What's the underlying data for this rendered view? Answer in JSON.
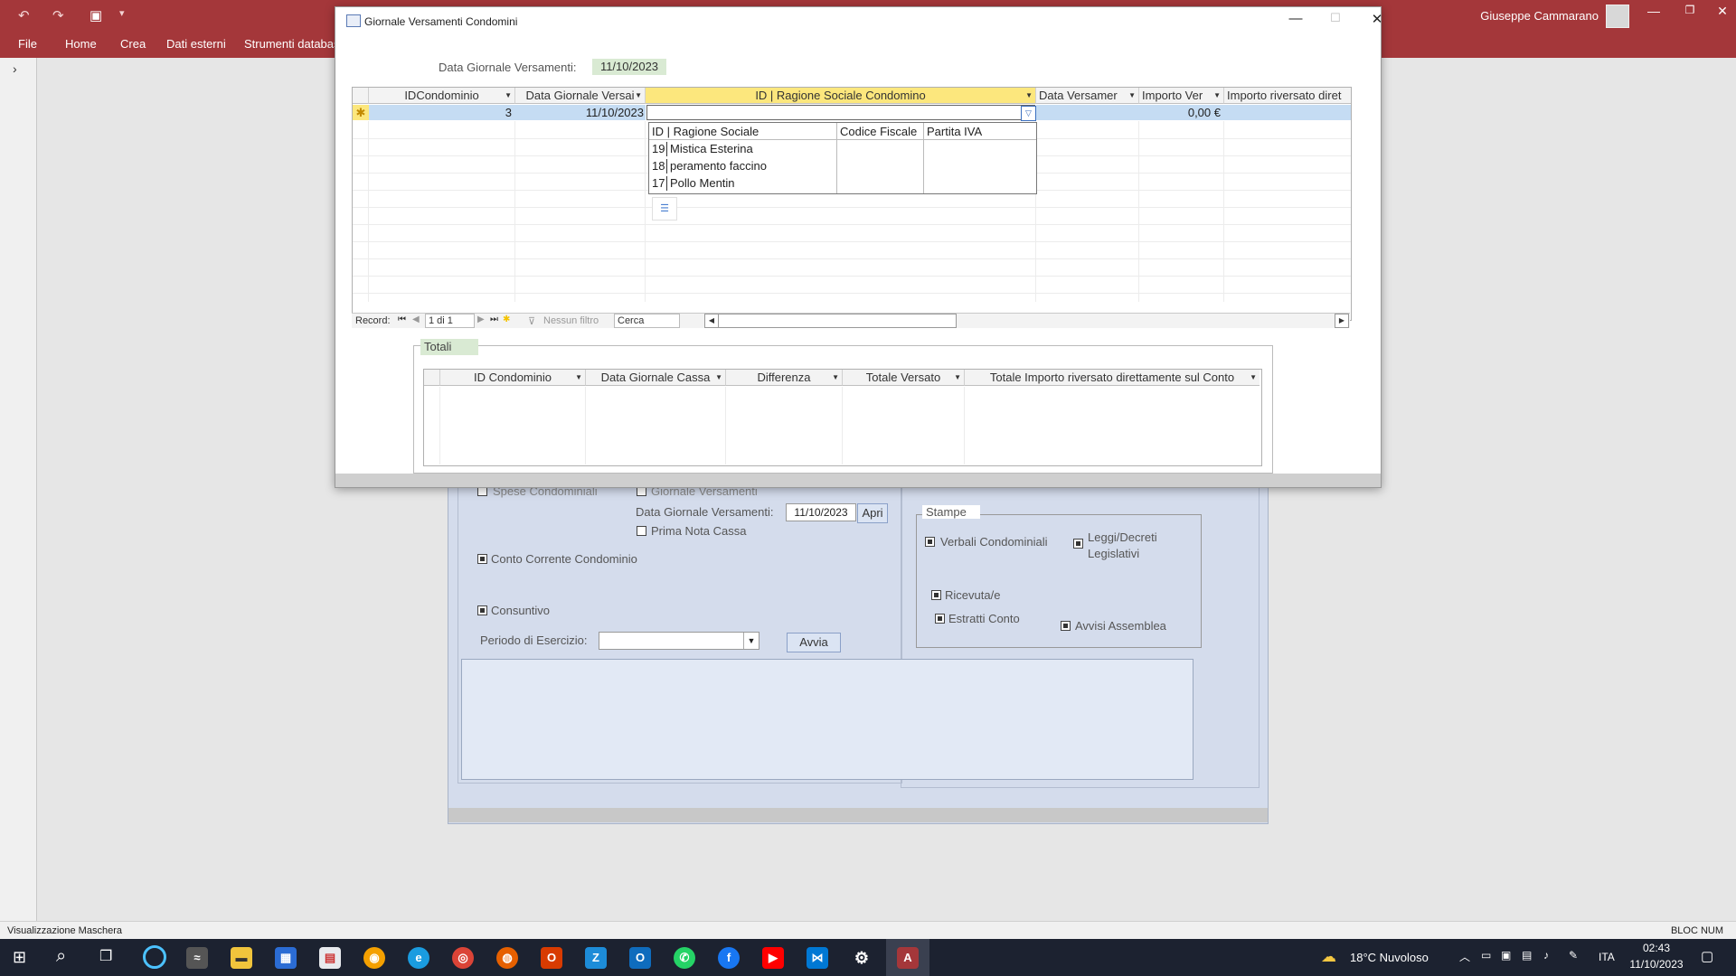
{
  "app": {
    "user_name": "Giuseppe Cammarano",
    "menu": [
      "File",
      "Home",
      "Crea",
      "Dati esterni",
      "Strumenti database"
    ]
  },
  "dialog": {
    "title": "Giornale Versamenti Condomini",
    "date_label": "Data Giornale Versamenti:",
    "date_value": "11/10/2023",
    "grid": {
      "columns": [
        "IDCondominio",
        "Data Giornale Versai",
        "ID | Ragione Sociale Condomino",
        "Data Versamer",
        "Importo Ver",
        "Importo riversato diret"
      ],
      "row": {
        "marker": "✱",
        "id_condominio": "3",
        "data_giornale": "11/10/2023",
        "ragione_sociale": "",
        "data_versamento": "",
        "importo": "0,00 €",
        "importo_riversato": ""
      }
    },
    "combo_list": {
      "columns": [
        "ID | Ragione Sociale",
        "Codice Fiscale",
        "Partita IVA"
      ],
      "rows": [
        {
          "id": "19",
          "name": "Mistica Esterina"
        },
        {
          "id": "18",
          "name": "peramento faccino"
        },
        {
          "id": "17",
          "name": "Pollo Mentin"
        }
      ]
    },
    "record_nav": {
      "label": "Record:",
      "position": "1 di 1",
      "filter": "Nessun filtro",
      "search": "Cerca"
    },
    "totals": {
      "label": "Totali",
      "columns": [
        "ID Condominio",
        "Data Giornale Cassa",
        "Differenza",
        "Totale Versato",
        "Totale Importo riversato direttamente sul Conto"
      ]
    }
  },
  "background_form": {
    "spese_condominiali": "Spese Condominiali",
    "giornale_versamenti": "Giornale Versamenti",
    "data_giornale_label": "Data Giornale Versamenti:",
    "data_giornale_value": "11/10/2023",
    "apri_button": "Apri",
    "prima_nota_cassa": "Prima Nota Cassa",
    "conto_corrente": "Conto Corrente Condominio",
    "consuntivo": "Consuntivo",
    "periodo_label": "Periodo di Esercizio:",
    "avvia_button": "Avvia",
    "stampe": {
      "label": "Stampe",
      "verbali": "Verbali Condominiali",
      "leggi_1": "Leggi/Decreti",
      "leggi_2": "Legislativi",
      "ricevute": "Ricevuta/e",
      "estratti": "Estratti Conto",
      "avvisi": "Avvisi Assemblea"
    }
  },
  "statusbar": {
    "left": "Visualizzazione Maschera",
    "right": "BLOC NUM"
  },
  "taskbar": {
    "weather": "18°C  Nuvoloso",
    "language": "ITA",
    "time": "02:43",
    "date": "11/10/2023"
  },
  "colors": {
    "access_red": "#a4373a",
    "selected_row": "#c5dcf3",
    "highlight_green": "#d9ead3"
  }
}
